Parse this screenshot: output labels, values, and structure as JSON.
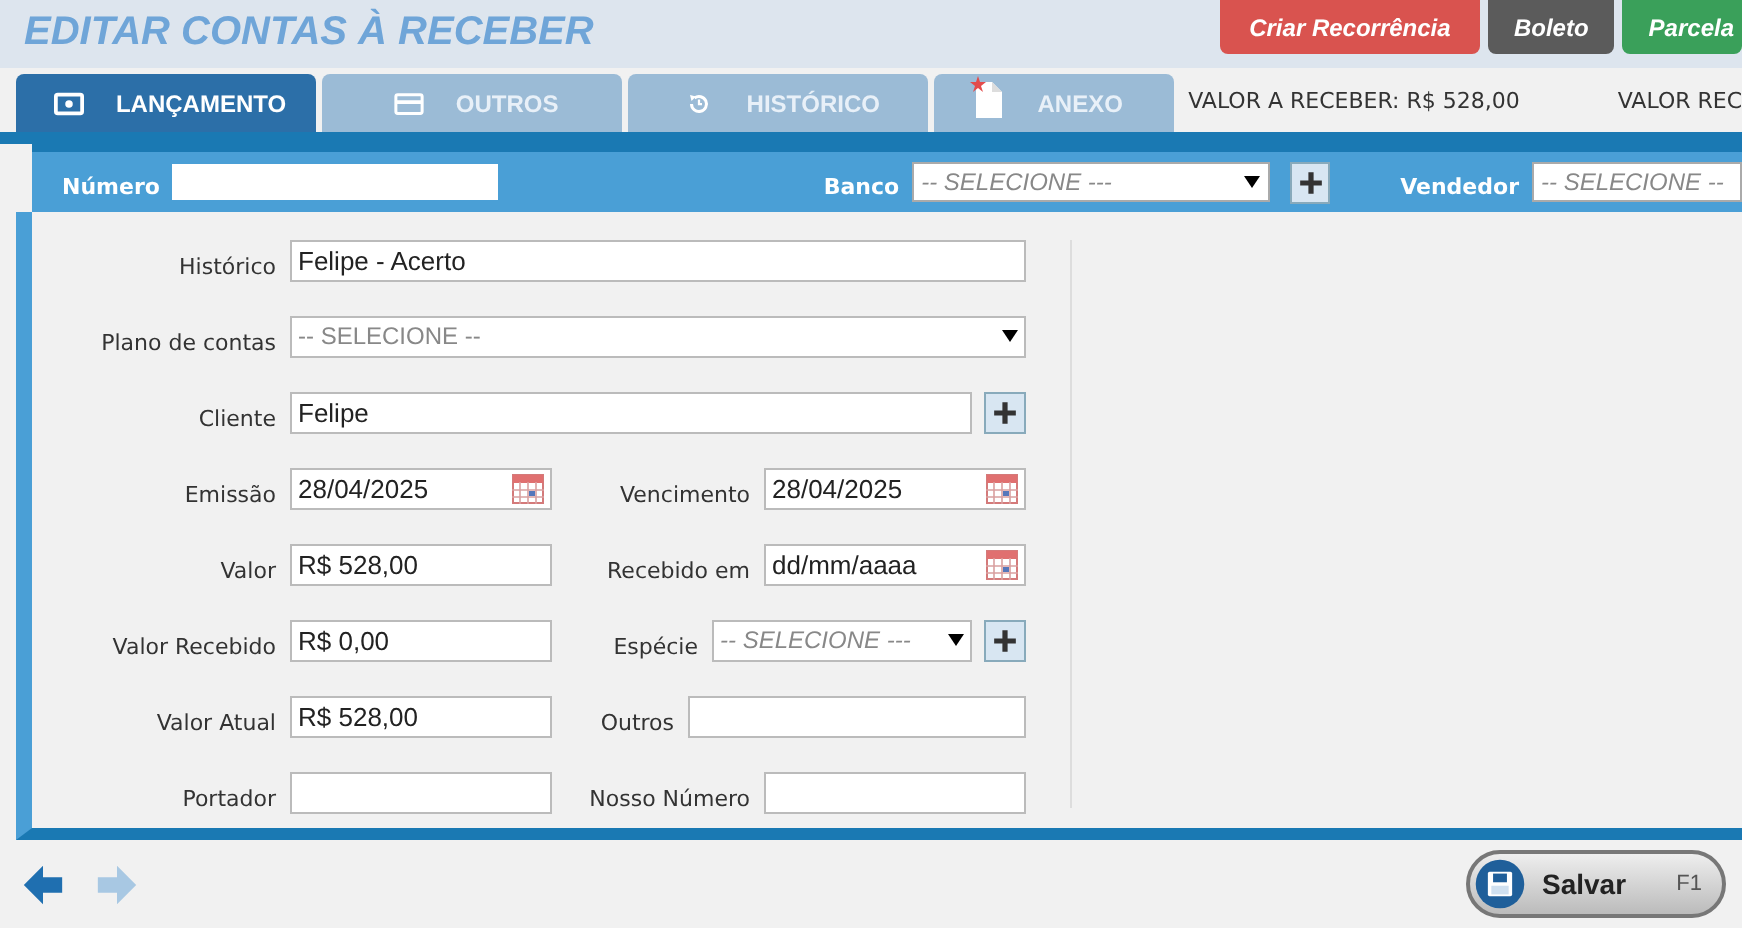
{
  "title": "EDITAR CONTAS À RECEBER",
  "actions": [
    {
      "label": "Criar Recorrência",
      "color": "#d9534f"
    },
    {
      "label": "Boleto",
      "color": "#5b5b5b"
    },
    {
      "label": "Parcela",
      "color": "#3aa05a"
    }
  ],
  "tabs": [
    {
      "label": "LANÇAMENTO",
      "selected": true
    },
    {
      "label": "OUTROS",
      "selected": false
    },
    {
      "label": "HISTÓRICO",
      "selected": false
    },
    {
      "label": "ANEXO",
      "selected": false
    }
  ],
  "totals": [
    "VALOR A RECEBER: R$ 528,00",
    "VALOR REC"
  ],
  "filter": {
    "numero": {
      "label": "Número"
    },
    "banco": {
      "label": "Banco",
      "placeholder": "-- SELECIONE ---"
    },
    "vendedor": {
      "label": "Vendedor",
      "placeholder": "-- SELECIONE --"
    }
  },
  "rows": [
    {
      "left": {
        "label": "Histórico",
        "kind": "text",
        "value": "Felipe - Acerto",
        "span": true
      }
    },
    {
      "left": {
        "label": "Plano de contas",
        "kind": "select",
        "placeholder": "-- SELECIONE --",
        "span": true
      }
    },
    {
      "left": {
        "label": "Cliente",
        "kind": "text",
        "value": "Felipe",
        "span": true,
        "add": true
      }
    },
    {
      "left": {
        "label": "Emissão",
        "kind": "date",
        "value": "28/04/2025"
      },
      "right": {
        "label": "Vencimento",
        "kind": "date",
        "value": "28/04/2025"
      }
    },
    {
      "left": {
        "label": "Valor",
        "kind": "text",
        "value": "R$ 528,00"
      },
      "right": {
        "label": "Recebido em",
        "kind": "date",
        "placeholder": "dd/mm/aaaa"
      }
    },
    {
      "left": {
        "label": "Valor Recebido",
        "kind": "text",
        "value": "R$ 0,00"
      },
      "right": {
        "label": "Espécie",
        "kind": "select",
        "placeholder": "-- SELECIONE ---",
        "add": true
      }
    },
    {
      "left": {
        "label": "Valor Atual",
        "kind": "text",
        "value": "R$ 528,00"
      },
      "right": {
        "label": "Outros",
        "kind": "text"
      }
    },
    {
      "left": {
        "label": "Portador",
        "kind": "text"
      },
      "right": {
        "label": "Nosso Número",
        "kind": "text"
      }
    }
  ],
  "save": {
    "label": "Salvar",
    "shortcut": "F1"
  }
}
